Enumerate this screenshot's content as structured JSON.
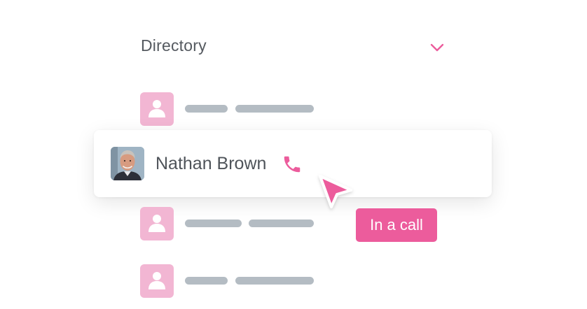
{
  "directory": {
    "title": "Directory",
    "collapse_icon": "chevron-down-icon"
  },
  "contact": {
    "name": "Nathan Brown",
    "call_icon": "phone-icon"
  },
  "status_badge": "In a call",
  "colors": {
    "accent": "#ec5c9c",
    "placeholder_avatar": "#f2b6d3",
    "skeleton_bar": "#b4bcc3",
    "text": "#4f545a"
  }
}
